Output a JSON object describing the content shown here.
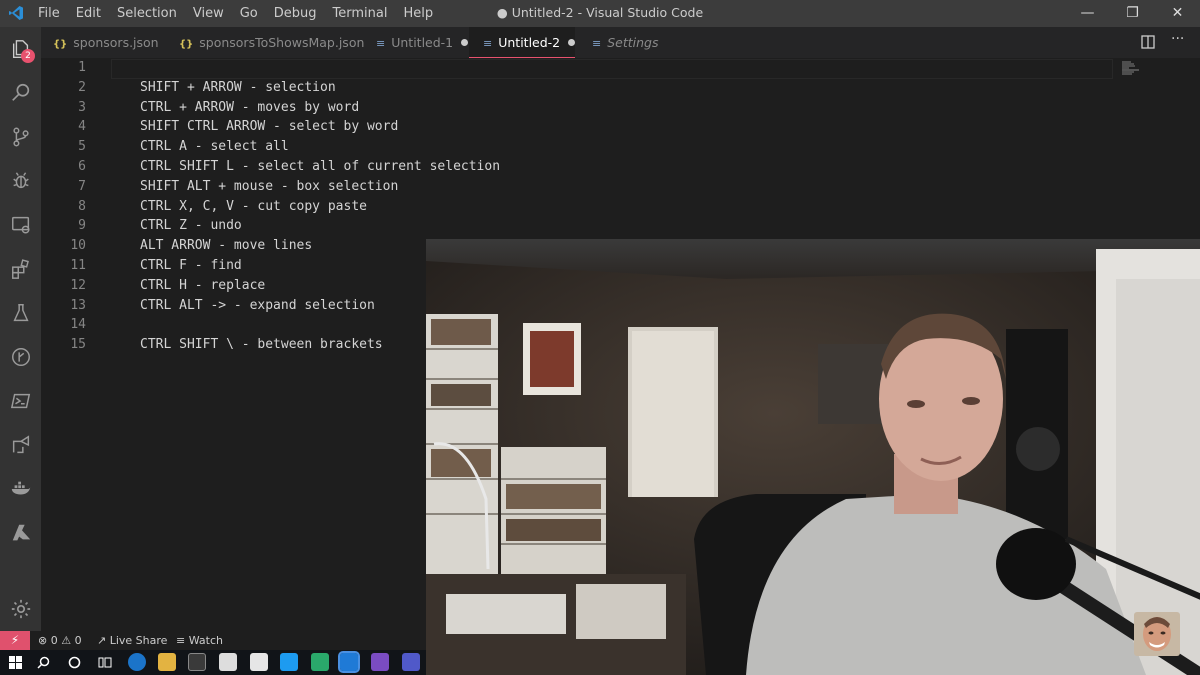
{
  "window": {
    "title": "● Untitled-2 - Visual Studio Code",
    "menu": [
      "File",
      "Edit",
      "Selection",
      "View",
      "Go",
      "Debug",
      "Terminal",
      "Help"
    ],
    "controls": [
      "—",
      "❐",
      "✕"
    ]
  },
  "activity_bar": {
    "badge": "2",
    "icons": [
      "explorer-icon",
      "search-icon",
      "source-control-icon",
      "debug-icon",
      "remote-explorer-icon",
      "extensions-icon",
      "testing-icon",
      "git-graph-icon",
      "powershell-icon",
      "live-share-icon",
      "docker-icon",
      "azure-icon",
      "gear-icon"
    ]
  },
  "tabs": [
    {
      "icon": "{}",
      "label": "sponsors.json",
      "active": false
    },
    {
      "icon": "{}",
      "label": "sponsorsToShowsMap.json",
      "active": false
    },
    {
      "icon": "≡",
      "label": "Untitled-1",
      "active": false,
      "dirty": true
    },
    {
      "icon": "≡",
      "label": "Untitled-2",
      "active": true,
      "dirty": true
    },
    {
      "icon": "≡",
      "label": "Settings",
      "active": false
    }
  ],
  "editor": {
    "lines": [
      {
        "n": "1",
        "text": ""
      },
      {
        "n": "2",
        "text": "SHIFT + ARROW - selection"
      },
      {
        "n": "3",
        "text": "CTRL + ARROW - moves by word"
      },
      {
        "n": "4",
        "text": "SHIFT CTRL ARROW - select by word"
      },
      {
        "n": "5",
        "text": "CTRL A - select all"
      },
      {
        "n": "6",
        "text": "CTRL SHIFT L - select all of current selection"
      },
      {
        "n": "7",
        "text": "SHIFT ALT + mouse - box selection"
      },
      {
        "n": "8",
        "text": "CTRL X, C, V - cut copy paste"
      },
      {
        "n": "9",
        "text": "CTRL Z - undo"
      },
      {
        "n": "10",
        "text": "ALT ARROW - move lines"
      },
      {
        "n": "11",
        "text": "CTRL F - find"
      },
      {
        "n": "12",
        "text": "CTRL H - replace"
      },
      {
        "n": "13",
        "text": "CTRL ALT -> - expand selection"
      },
      {
        "n": "14",
        "text": ""
      },
      {
        "n": "15",
        "text": "CTRL SHIFT \\ - between brackets"
      }
    ]
  },
  "status_bar": {
    "remote": "⚡",
    "errors": "0",
    "warnings": "0",
    "live_share": "Live Share",
    "watch": "Watch"
  },
  "colors": {
    "accent": "#e8526e",
    "editor_bg": "#1e1e1e",
    "activity_bg": "#333333",
    "titlebar_bg": "#3c3c3c",
    "text": "#d4d4d4",
    "line_numbers": "#858585"
  }
}
